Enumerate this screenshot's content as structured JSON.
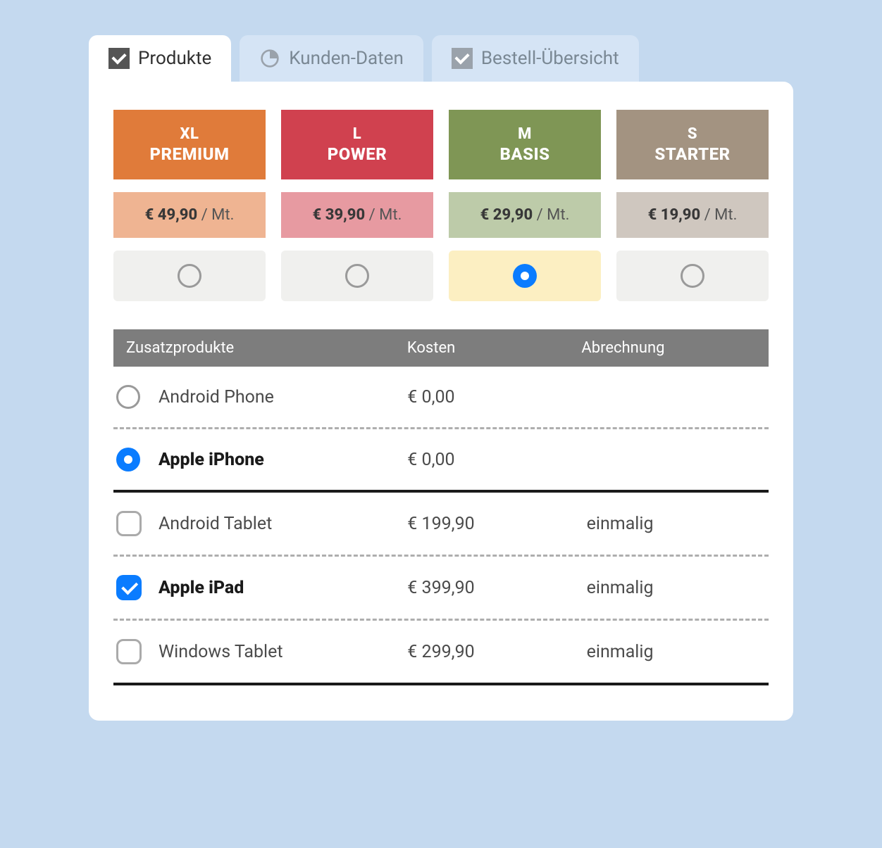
{
  "tabs": {
    "produkte": "Produkte",
    "kunden": "Kunden-Daten",
    "bestell": "Bestell-Übersicht"
  },
  "plans": [
    {
      "tier": "XL",
      "name": "PREMIUM",
      "price": "€ 49,90",
      "per": " / Mt.",
      "header_bg": "#e07b3a",
      "price_bg": "#efb492",
      "selected": false
    },
    {
      "tier": "L",
      "name": "POWER",
      "price": "€ 39,90",
      "per": " / Mt.",
      "header_bg": "#d0414f",
      "price_bg": "#e79aa1",
      "selected": false
    },
    {
      "tier": "M",
      "name": "BASIS",
      "price": "€ 29,90",
      "per": " / Mt.",
      "header_bg": "#7f9655",
      "price_bg": "#bdcba9",
      "selected": true
    },
    {
      "tier": "S",
      "name": "STARTER",
      "price": "€ 19,90",
      "per": " / Mt.",
      "header_bg": "#a39381",
      "price_bg": "#cfc7bf",
      "selected": false
    }
  ],
  "table": {
    "col_name": "Zusatzprodukte",
    "col_cost": "Kosten",
    "col_billing": "Abrechnung"
  },
  "addons": [
    {
      "control": "radio",
      "selected": false,
      "name": "Android Phone",
      "cost": "€ 0,00",
      "billing": "",
      "divider": "dashed"
    },
    {
      "control": "radio",
      "selected": true,
      "name": "Apple iPhone",
      "cost": "€ 0,00",
      "billing": "",
      "divider": "solid"
    },
    {
      "control": "checkbox",
      "selected": false,
      "name": "Android Tablet",
      "cost": "€ 199,90",
      "billing": "einmalig",
      "divider": "dashed"
    },
    {
      "control": "checkbox",
      "selected": true,
      "name": "Apple iPad",
      "cost": "€ 399,90",
      "billing": "einmalig",
      "divider": "dashed"
    },
    {
      "control": "checkbox",
      "selected": false,
      "name": "Windows Tablet",
      "cost": "€ 299,90",
      "billing": "einmalig",
      "divider": "solid"
    }
  ]
}
